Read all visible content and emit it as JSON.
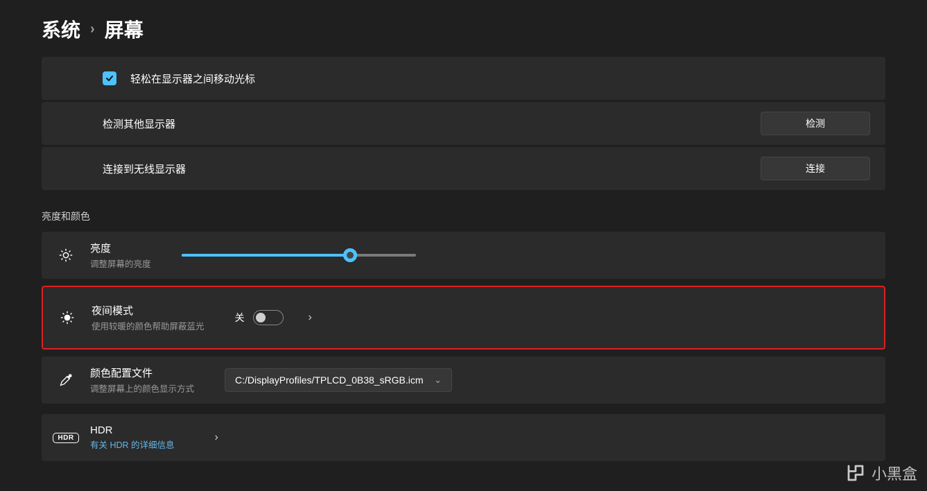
{
  "breadcrumb": {
    "parent": "系统",
    "current": "屏幕"
  },
  "multi_display": {
    "easy_cursor_label": "轻松在显示器之间移动光标",
    "easy_cursor_checked": true,
    "detect_label": "检测其他显示器",
    "detect_button": "检测",
    "wireless_label": "连接到无线显示器",
    "wireless_button": "连接"
  },
  "section_brightness_title": "亮度和颜色",
  "brightness": {
    "title": "亮度",
    "subtitle": "调整屏幕的亮度",
    "value_percent": 72
  },
  "night_light": {
    "title": "夜间模式",
    "subtitle": "使用较暖的颜色帮助屏蔽蓝光",
    "state_label": "关",
    "enabled": false
  },
  "color_profile": {
    "title": "颜色配置文件",
    "subtitle": "调整屏幕上的颜色显示方式",
    "selected": "C:/DisplayProfiles/TPLCD_0B38_sRGB.icm"
  },
  "hdr": {
    "title": "HDR",
    "subtitle": "有关 HDR 的详细信息"
  },
  "watermark": "小黑盒"
}
